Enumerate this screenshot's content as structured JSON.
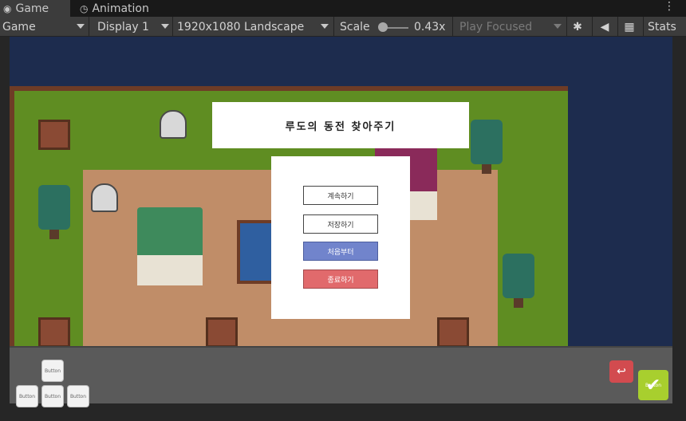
{
  "tabs": [
    {
      "label": "Game",
      "icon": "gamepad-icon"
    },
    {
      "label": "Animation",
      "icon": "clock-icon"
    }
  ],
  "toolbar": {
    "display_mode": "Game",
    "display": "Display 1",
    "resolution": "1920x1080 Landscape",
    "scale_label": "Scale",
    "scale_value": "0.43x",
    "play_mode": "Play Focused",
    "stats_label": "Stats"
  },
  "game": {
    "title": "루도의 동전 찾아주기",
    "menu": {
      "continue": "계속하기",
      "save": "저장하기",
      "restart": "처음부터",
      "quit": "종료하기"
    },
    "dpad": {
      "up": "Button",
      "left": "Button",
      "down": "Button",
      "right": "Button"
    },
    "ok_button": "Button",
    "colors": {
      "restart_button": "#7184cc",
      "quit_button": "#e16a6c",
      "ok_button": "#a8cf2e",
      "back_button": "#d24b4f",
      "background": "#1d2c4e"
    }
  }
}
